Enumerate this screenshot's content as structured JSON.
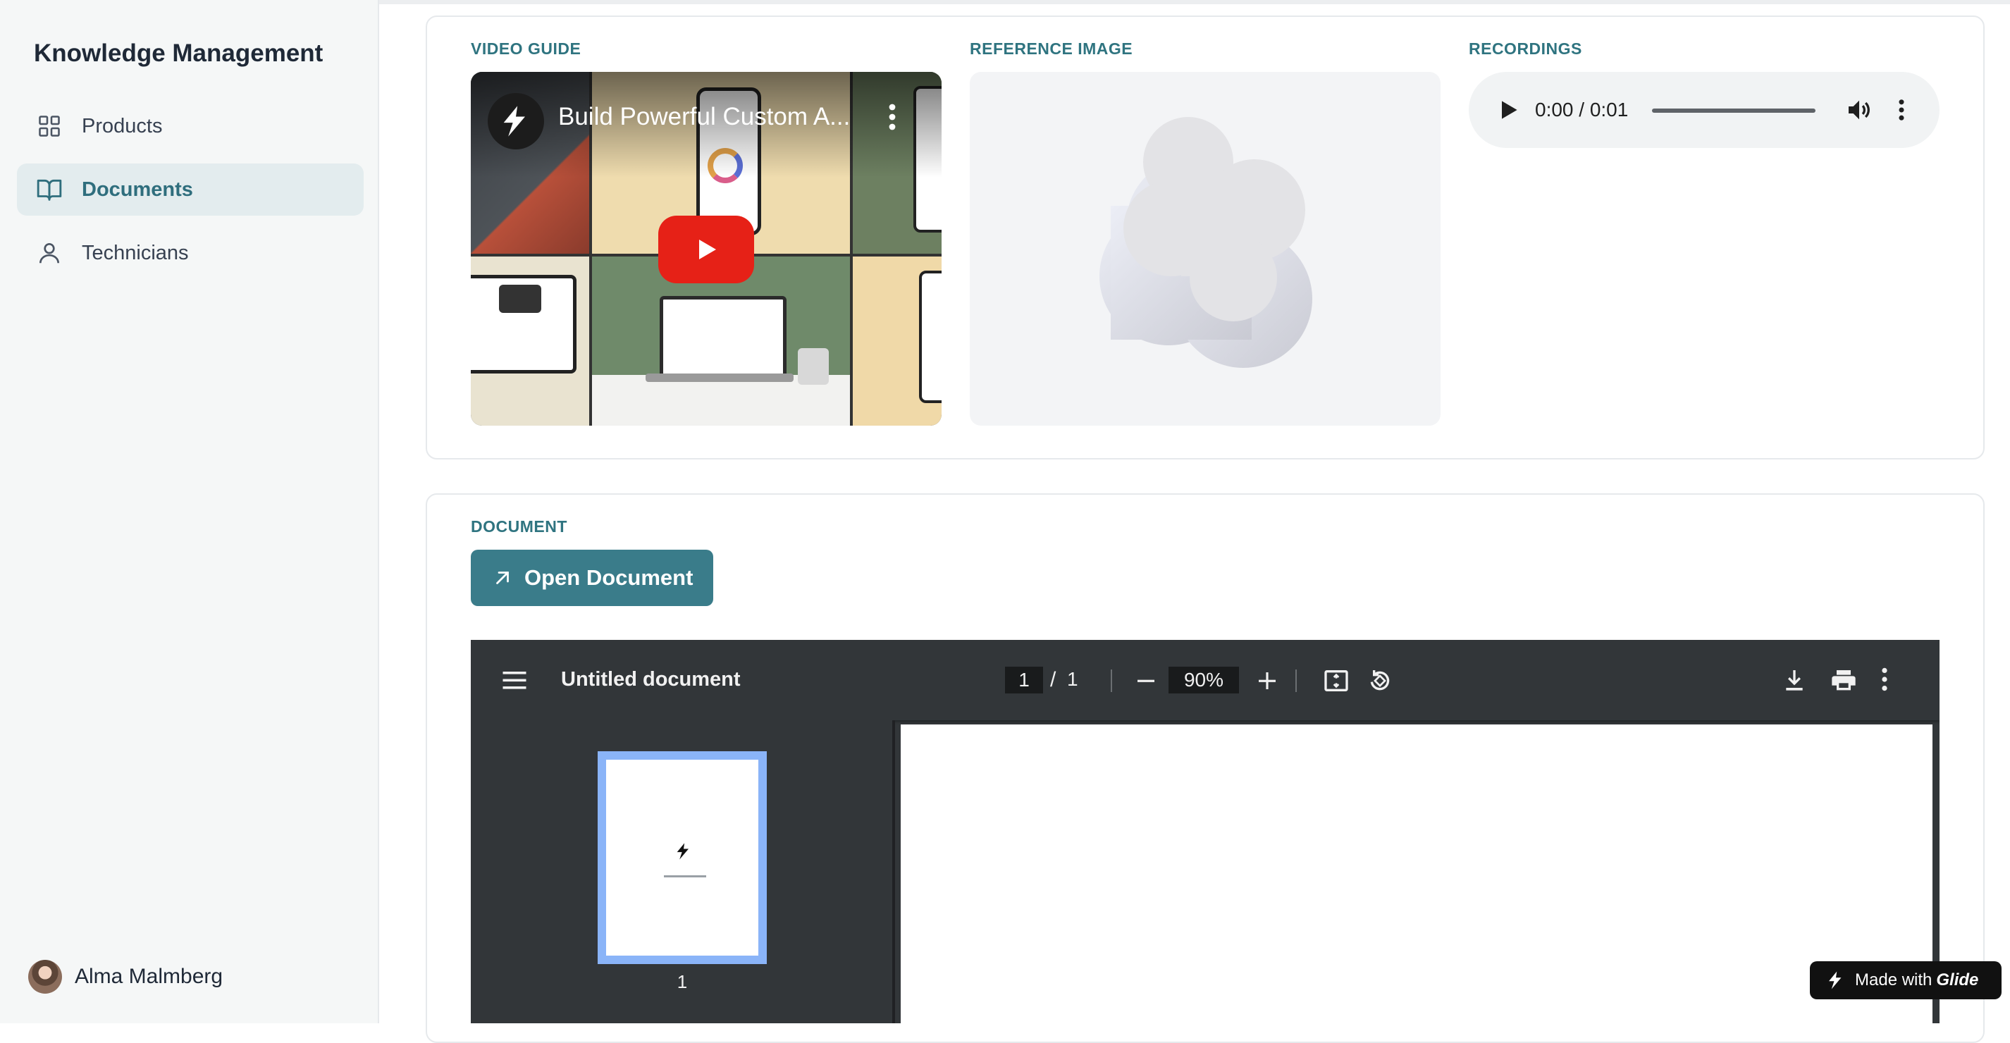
{
  "app": {
    "title": "Knowledge Management"
  },
  "sidebar": {
    "items": [
      {
        "label": "Products",
        "icon": "grid-icon",
        "active": false
      },
      {
        "label": "Documents",
        "icon": "book-icon",
        "active": true
      },
      {
        "label": "Technicians",
        "icon": "person-icon",
        "active": false
      }
    ],
    "user": {
      "name": "Alma Malmberg"
    }
  },
  "media": {
    "video_label": "VIDEO GUIDE",
    "video_title": "Build Powerful Custom A...",
    "reference_label": "REFERENCE IMAGE",
    "recordings_label": "RECORDINGS",
    "audio_time": "0:00 / 0:01"
  },
  "document": {
    "label": "DOCUMENT",
    "open_button": "Open Document",
    "viewer": {
      "title": "Untitled document",
      "current_page": "1",
      "separator": "/",
      "total_pages": "1",
      "zoom": "90%",
      "thumbnail_number": "1"
    }
  },
  "badge": {
    "prefix": "Made with",
    "brand": "Glide"
  },
  "colors": {
    "accent": "#3a7c8a",
    "active_bg": "#e3ecee",
    "pdf_bg": "#323639"
  }
}
